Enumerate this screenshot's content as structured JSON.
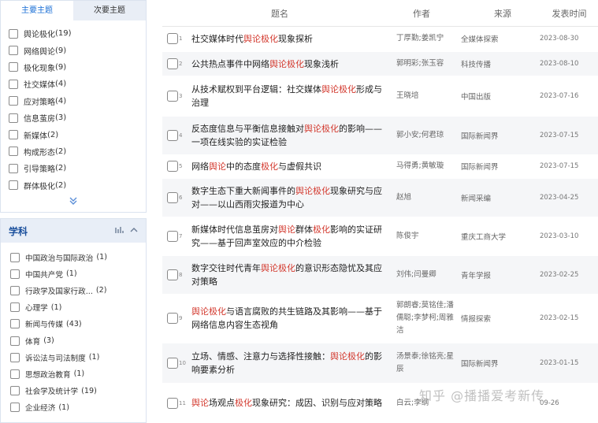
{
  "topic_tabs": {
    "primary": "主要主题",
    "secondary": "次要主题"
  },
  "topic_filters": [
    {
      "label": "舆论极化",
      "count": "(19)"
    },
    {
      "label": "网络舆论",
      "count": "(9)"
    },
    {
      "label": "极化现象",
      "count": "(9)"
    },
    {
      "label": "社交媒体",
      "count": "(4)"
    },
    {
      "label": "应对策略",
      "count": "(4)"
    },
    {
      "label": "信息茧房",
      "count": "(3)"
    },
    {
      "label": "新媒体",
      "count": "(2)"
    },
    {
      "label": "构成形态",
      "count": "(2)"
    },
    {
      "label": "引导策略",
      "count": "(2)"
    },
    {
      "label": "群体极化",
      "count": "(2)"
    }
  ],
  "more_icon": "double-chevron-down-icon",
  "subject": {
    "title": "学科",
    "chart_icon": "bar-chart-icon",
    "collapse_icon": "chevron-up-icon"
  },
  "subject_filters": [
    {
      "label": "中国政治与国际政治",
      "count": "(1)"
    },
    {
      "label": "中国共产党",
      "count": "(1)"
    },
    {
      "label": "行政学及国家行政...",
      "count": "(2)"
    },
    {
      "label": "心理学",
      "count": "(1)"
    },
    {
      "label": "新闻与传媒",
      "count": "(43)"
    },
    {
      "label": "体育",
      "count": "(3)"
    },
    {
      "label": "诉讼法与司法制度",
      "count": "(1)"
    },
    {
      "label": "思想政治教育",
      "count": "(1)"
    },
    {
      "label": "社会学及统计学",
      "count": "(19)"
    },
    {
      "label": "企业经济",
      "count": "(1)"
    }
  ],
  "table": {
    "headers": {
      "title": "题名",
      "author": "作者",
      "source": "来源",
      "date": "发表时间"
    },
    "rows": [
      {
        "num": "1",
        "title": [
          [
            "社交媒体时代",
            ""
          ],
          [
            "舆论极化",
            "hl"
          ],
          [
            "现象探析",
            ""
          ]
        ],
        "author": "丁厚勤;姜凯宁",
        "source": "全媒体探索",
        "date": "2023-08-30"
      },
      {
        "num": "2",
        "title": [
          [
            "公共热点事件中网络",
            ""
          ],
          [
            "舆论极化",
            "hl"
          ],
          [
            "现象浅析",
            ""
          ]
        ],
        "author": "郭明彩;张玉容",
        "source": "科技传播",
        "date": "2023-08-10"
      },
      {
        "num": "3",
        "title": [
          [
            "从技术赋权到平台逻辑：社交媒体",
            ""
          ],
          [
            "舆论极化",
            "hl"
          ],
          [
            "形成与治理",
            ""
          ]
        ],
        "author": "王晓培",
        "source": "中国出版",
        "date": "2023-07-16"
      },
      {
        "num": "4",
        "title": [
          [
            "反态度信息与平衡信息接触对",
            ""
          ],
          [
            "舆论极化",
            "hl"
          ],
          [
            "的影响——一项在线实验的实证检验",
            ""
          ]
        ],
        "author": "郭小安;何君琼",
        "source": "国际新闻界",
        "date": "2023-07-15"
      },
      {
        "num": "5",
        "title": [
          [
            "网络",
            ""
          ],
          [
            "舆论",
            "hl"
          ],
          [
            "中的态度",
            ""
          ],
          [
            "极化",
            "hl"
          ],
          [
            "与虚假共识",
            ""
          ]
        ],
        "author": "马得勇;黄敏璇",
        "source": "国际新闻界",
        "date": "2023-07-15"
      },
      {
        "num": "6",
        "title": [
          [
            "数字生态下重大新闻事件的",
            ""
          ],
          [
            "舆论极化",
            "hl"
          ],
          [
            "现象研究与应对——以山西雨灾报道为中心",
            ""
          ]
        ],
        "author": "赵旭",
        "source": "新闻采编",
        "date": "2023-04-25"
      },
      {
        "num": "7",
        "title": [
          [
            "新媒体时代信息茧房对",
            ""
          ],
          [
            "舆论",
            "hl"
          ],
          [
            "群体",
            ""
          ],
          [
            "极化",
            "hl"
          ],
          [
            "影响的实证研究——基于回声室效应的中介检验",
            ""
          ]
        ],
        "author": "陈俊宇",
        "source": "重庆工商大学",
        "date": "2023-03-10"
      },
      {
        "num": "8",
        "title": [
          [
            "数字交往时代青年",
            ""
          ],
          [
            "舆论极化",
            "hl"
          ],
          [
            "的意识形态隐忧及其应对策略",
            ""
          ]
        ],
        "author": "刘伟;闫曼卿",
        "source": "青年学报",
        "date": "2023-02-25"
      },
      {
        "num": "9",
        "title": [
          [
            "舆论极化",
            "hl"
          ],
          [
            "与语言腐败的共生链路及其影响——基于网络信息内容生态视角",
            ""
          ]
        ],
        "author": "郭朗睿;莫铭佳;潘儒聪;李梦柯;周雅洁",
        "source": "情报探索",
        "date": "2023-02-15"
      },
      {
        "num": "10",
        "title": [
          [
            "立场、情感、注意力与选择性接触：",
            ""
          ],
          [
            "舆论极化",
            "hl"
          ],
          [
            "的影响要素分析",
            ""
          ]
        ],
        "author": "汤景泰;徐铭亮;星辰",
        "source": "国际新闻界",
        "date": "2023-01-15"
      },
      {
        "num": "11",
        "title": [
          [
            "舆论",
            "hl"
          ],
          [
            "场观点",
            ""
          ],
          [
            "极化",
            "hl"
          ],
          [
            "现象研究：成因、识别与应对策略",
            ""
          ]
        ],
        "author": "白云;李纲",
        "source": "",
        "date": "09-26"
      }
    ]
  },
  "watermark": "知乎 @播播爱考新传"
}
